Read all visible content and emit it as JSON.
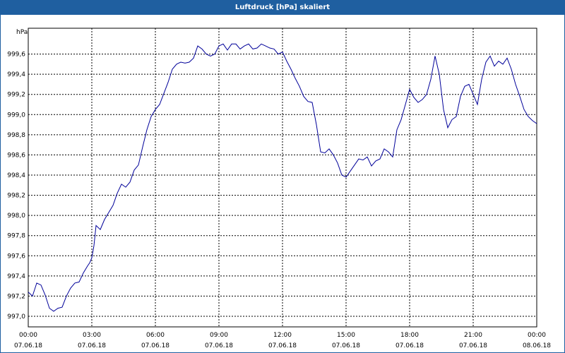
{
  "window": {
    "title": "Luftdruck [hPa] skaliert"
  },
  "chart_data": {
    "type": "line",
    "title": "Luftdruck [hPa] skaliert",
    "ylabel": "hPa",
    "xlabel": "",
    "ylim": [
      997.0,
      999.8
    ],
    "xlim": [
      "07.06.18 00:00",
      "08.06.18 00:00"
    ],
    "grid": true,
    "line_color": "#000099",
    "y_ticks": [
      "997,0",
      "997,2",
      "997,4",
      "997,6",
      "997,8",
      "998,0",
      "998,2",
      "998,4",
      "998,6",
      "998,8",
      "999,0",
      "999,2",
      "999,4",
      "999,6"
    ],
    "x_ticks": [
      {
        "time": "00:00",
        "date": "07.06.18"
      },
      {
        "time": "03:00",
        "date": "07.06.18"
      },
      {
        "time": "06:00",
        "date": "07.06.18"
      },
      {
        "time": "09:00",
        "date": "07.06.18"
      },
      {
        "time": "12:00",
        "date": "07.06.18"
      },
      {
        "time": "15:00",
        "date": "07.06.18"
      },
      {
        "time": "18:00",
        "date": "07.06.18"
      },
      {
        "time": "21:00",
        "date": "07.06.18"
      },
      {
        "time": "00:00",
        "date": "08.06.18"
      }
    ],
    "series": [
      {
        "x_hours": [
          0,
          0.2,
          0.4,
          0.6,
          0.8,
          1.0,
          1.2,
          1.4,
          1.6,
          1.8,
          2.0,
          2.2,
          2.4,
          2.6,
          2.8,
          2.9,
          3.0,
          3.1,
          3.2,
          3.4,
          3.6,
          3.8,
          4.0,
          4.2,
          4.4,
          4.6,
          4.8,
          5.0,
          5.2,
          5.4,
          5.6,
          5.8,
          6.0,
          6.2,
          6.4,
          6.6,
          6.8,
          7.0,
          7.2,
          7.4,
          7.6,
          7.8,
          8.0,
          8.2,
          8.4,
          8.6,
          8.8,
          9.0,
          9.2,
          9.4,
          9.6,
          9.8,
          10.0,
          10.2,
          10.4,
          10.6,
          10.8,
          11.0,
          11.2,
          11.4,
          11.6,
          11.8,
          12.0,
          12.2,
          12.4,
          12.6,
          12.8,
          13.0,
          13.2,
          13.4,
          13.6,
          13.8,
          14.0,
          14.2,
          14.4,
          14.6,
          14.8,
          15.0,
          15.2,
          15.4,
          15.6,
          15.8,
          16.0,
          16.2,
          16.4,
          16.6,
          16.8,
          17.0,
          17.2,
          17.4,
          17.6,
          17.8,
          18.0,
          18.2,
          18.4,
          18.6,
          18.8,
          19.0,
          19.2,
          19.4,
          19.6,
          19.8,
          20.0,
          20.2,
          20.4,
          20.6,
          20.8,
          21.0,
          21.2,
          21.4,
          21.6,
          21.8,
          22.0,
          22.2,
          22.4,
          22.6,
          22.8,
          23.0,
          23.2,
          23.4,
          23.6,
          23.8,
          24.0
        ],
        "values": [
          997.24,
          997.2,
          997.33,
          997.31,
          997.21,
          997.08,
          997.05,
          997.08,
          997.09,
          997.2,
          997.28,
          997.33,
          997.34,
          997.43,
          997.5,
          997.53,
          997.58,
          997.7,
          997.9,
          997.86,
          997.96,
          998.03,
          998.1,
          998.22,
          998.31,
          998.28,
          998.33,
          998.45,
          998.5,
          998.68,
          998.85,
          998.98,
          999.05,
          999.1,
          999.21,
          999.32,
          999.45,
          999.5,
          999.52,
          999.51,
          999.52,
          999.56,
          999.68,
          999.65,
          999.6,
          999.58,
          999.6,
          999.68,
          999.7,
          999.64,
          999.7,
          999.7,
          999.65,
          999.68,
          999.7,
          999.65,
          999.66,
          999.7,
          999.68,
          999.66,
          999.65,
          999.6,
          999.62,
          999.53,
          999.45,
          999.36,
          999.28,
          999.18,
          999.13,
          999.12,
          998.9,
          998.63,
          998.62,
          998.66,
          998.6,
          998.52,
          998.4,
          998.38,
          998.44,
          998.5,
          998.56,
          998.55,
          998.58,
          998.49,
          998.54,
          998.56,
          998.66,
          998.63,
          998.58,
          998.85,
          998.95,
          999.1,
          999.25,
          999.17,
          999.12,
          999.15,
          999.2,
          999.35,
          999.58,
          999.4,
          999.05,
          998.87,
          998.95,
          998.98,
          999.18,
          999.28,
          999.3,
          999.2,
          999.1,
          999.35,
          999.52,
          999.58,
          999.48,
          999.53,
          999.5,
          999.56,
          999.45,
          999.3,
          999.18,
          999.05,
          998.98,
          998.94,
          998.91,
          998.95,
          999.0
        ]
      }
    ]
  }
}
